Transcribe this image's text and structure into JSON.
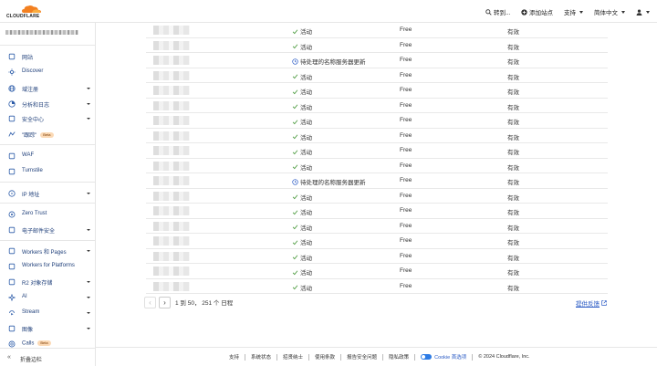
{
  "header": {
    "logo_text": "CLOUDFLARE",
    "goto_label": "转到...",
    "add_site_label": "添加站点",
    "support_label": "支持",
    "language_label": "简体中文"
  },
  "sidebar": {
    "items": [
      {
        "label": "网站",
        "icon": "websites-icon",
        "chev": false
      },
      {
        "label": "Discover",
        "icon": "discover-icon",
        "chev": false
      },
      {
        "label": "域注册",
        "icon": "globe-icon",
        "chev": true
      },
      {
        "label": "分析和日志",
        "icon": "analytics-icon",
        "chev": true
      },
      {
        "label": "安全中心",
        "icon": "security-center-icon",
        "chev": true
      },
      {
        "label": "\"跟踪\"",
        "icon": "trace-icon",
        "chev": false,
        "beta": "Beta"
      },
      {
        "label": "WAF",
        "icon": "waf-icon",
        "chev": false
      },
      {
        "label": "Turnstile",
        "icon": "turnstile-icon",
        "chev": false
      },
      {
        "label": "IP 地址",
        "icon": "ip-address-icon",
        "chev": true
      },
      {
        "label": "Zero Trust",
        "icon": "zero-trust-icon",
        "chev": false
      },
      {
        "label": "电子邮件安全",
        "icon": "email-security-icon",
        "chev": true
      },
      {
        "label": "Workers 和 Pages",
        "icon": "workers-icon",
        "chev": true
      },
      {
        "label": "Workers for Platforms",
        "icon": "workers-platforms-icon",
        "chev": false
      },
      {
        "label": "R2 对象存储",
        "icon": "r2-storage-icon",
        "chev": true
      },
      {
        "label": "AI",
        "icon": "ai-icon",
        "chev": true
      },
      {
        "label": "Stream",
        "icon": "stream-icon",
        "chev": true
      },
      {
        "label": "图像",
        "icon": "images-icon",
        "chev": true
      },
      {
        "label": "Calls",
        "icon": "calls-icon",
        "chev": false,
        "beta": "Beta"
      }
    ],
    "collapse_label": "折叠边栏"
  },
  "table": {
    "rows": [
      {
        "status": "活动",
        "status_icon": "check-icon",
        "plan": "Free",
        "validity": "有效"
      },
      {
        "status": "活动",
        "status_icon": "check-icon",
        "plan": "Free",
        "validity": "有效"
      },
      {
        "status": "待处理的名称服务器更新",
        "status_icon": "clock-icon",
        "plan": "Free",
        "validity": "有效"
      },
      {
        "status": "活动",
        "status_icon": "check-icon",
        "plan": "Free",
        "validity": "有效"
      },
      {
        "status": "活动",
        "status_icon": "check-icon",
        "plan": "Free",
        "validity": "有效"
      },
      {
        "status": "活动",
        "status_icon": "check-icon",
        "plan": "Free",
        "validity": "有效"
      },
      {
        "status": "活动",
        "status_icon": "check-icon",
        "plan": "Free",
        "validity": "有效"
      },
      {
        "status": "活动",
        "status_icon": "check-icon",
        "plan": "Free",
        "validity": "有效"
      },
      {
        "status": "活动",
        "status_icon": "check-icon",
        "plan": "Free",
        "validity": "有效"
      },
      {
        "status": "活动",
        "status_icon": "check-icon",
        "plan": "Free",
        "validity": "有效"
      },
      {
        "status": "待处理的名称服务器更新",
        "status_icon": "clock-icon",
        "plan": "Free",
        "validity": "有效"
      },
      {
        "status": "活动",
        "status_icon": "check-icon",
        "plan": "Free",
        "validity": "有效"
      },
      {
        "status": "活动",
        "status_icon": "check-icon",
        "plan": "Free",
        "validity": "有效"
      },
      {
        "status": "活动",
        "status_icon": "check-icon",
        "plan": "Free",
        "validity": "有效"
      },
      {
        "status": "活动",
        "status_icon": "check-icon",
        "plan": "Free",
        "validity": "有效"
      },
      {
        "status": "活动",
        "status_icon": "check-icon",
        "plan": "Free",
        "validity": "有效"
      },
      {
        "status": "活动",
        "status_icon": "check-icon",
        "plan": "Free",
        "validity": "有效"
      },
      {
        "status": "活动",
        "status_icon": "check-icon",
        "plan": "Free",
        "validity": "有效"
      }
    ]
  },
  "pagination": {
    "info": "1 到 50， 251 个 日程",
    "feedback_label": "提供反馈"
  },
  "footer": {
    "links": [
      "支持",
      "系统状态",
      "招贤纳士",
      "使用条款",
      "报告安全问题",
      "隐私政策"
    ],
    "cookie_label": "Cookie 首选项",
    "copyright": "© 2024 Cloudflare, Inc."
  },
  "colors": {
    "brand_orange": "#f38020",
    "link_blue": "#2c5cc5",
    "sidebar_text": "#1f3f7a",
    "status_green": "#4a9a3d"
  }
}
